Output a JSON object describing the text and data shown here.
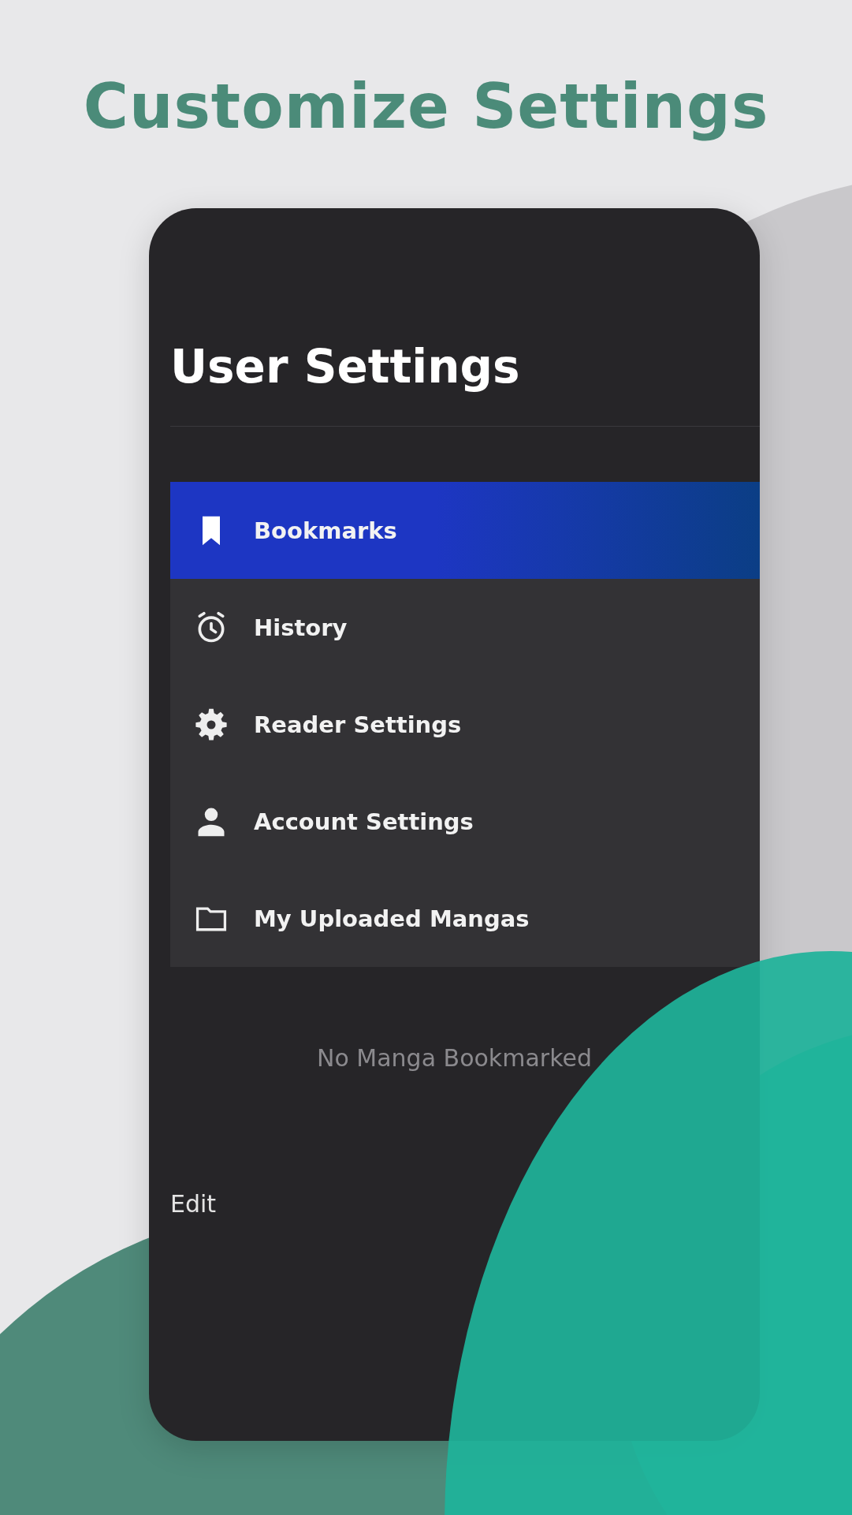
{
  "heading": "Customize Settings",
  "screen": {
    "title": "User Settings",
    "menu": [
      {
        "label": "Bookmarks",
        "kind": "bookmark",
        "selected": true
      },
      {
        "label": "History",
        "kind": "alarm",
        "selected": false
      },
      {
        "label": "Reader Settings",
        "kind": "gear",
        "selected": false
      },
      {
        "label": "Account Settings",
        "kind": "person",
        "selected": false
      },
      {
        "label": "My Uploaded Mangas",
        "kind": "folder",
        "selected": false
      }
    ],
    "empty_message": "No Manga Bookmarked",
    "edit_button": "Edit"
  }
}
